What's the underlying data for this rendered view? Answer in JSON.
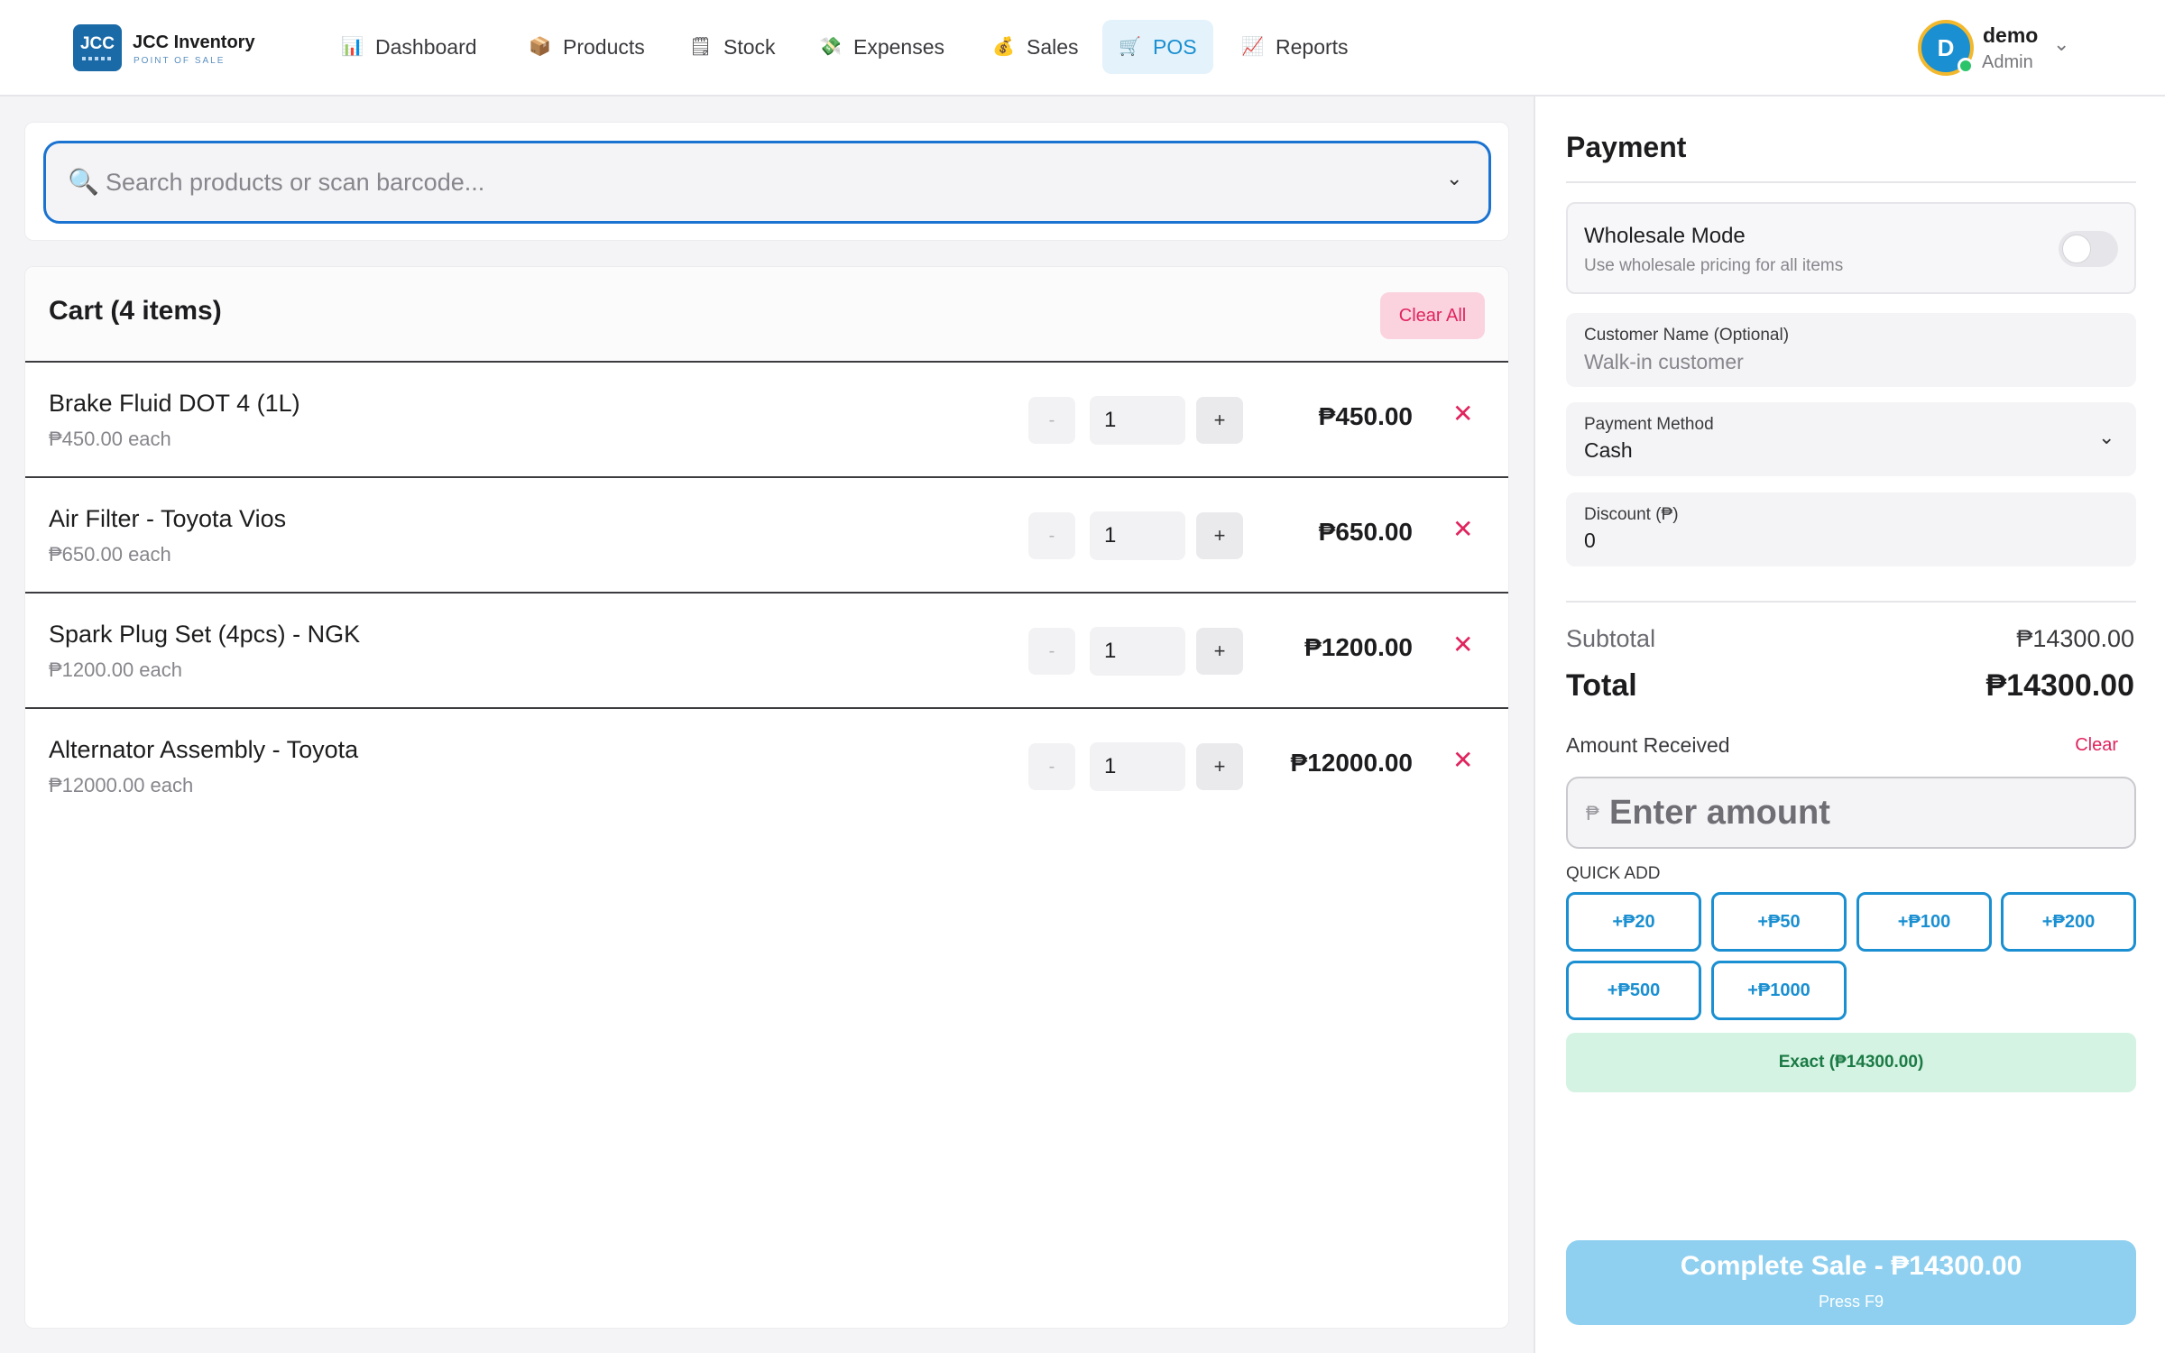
{
  "brand": {
    "logo_text": "JCC",
    "name": "JCC Inventory",
    "subtitle": "POINT OF SALE"
  },
  "nav": [
    {
      "label": "Dashboard",
      "icon": "📊",
      "icon_name": "bar-chart-icon"
    },
    {
      "label": "Products",
      "icon": "📦",
      "icon_name": "package-icon"
    },
    {
      "label": "Stock",
      "icon": "🗒",
      "icon_name": "clipboard-icon"
    },
    {
      "label": "Expenses",
      "icon": "💸",
      "icon_name": "money-wings-icon"
    },
    {
      "label": "Sales",
      "icon": "💰",
      "icon_name": "money-bag-icon"
    },
    {
      "label": "POS",
      "icon": "🛒",
      "icon_name": "cart-icon",
      "active": true
    },
    {
      "label": "Reports",
      "icon": "📈",
      "icon_name": "line-chart-icon"
    }
  ],
  "user": {
    "initial": "D",
    "name": "demo",
    "role": "Admin"
  },
  "search": {
    "placeholder": "Search products or scan barcode..."
  },
  "cart": {
    "title": "Cart (4 items)",
    "clear_all": "Clear All",
    "items": [
      {
        "name": "Brake Fluid DOT 4 (1L)",
        "each": "₱450.00 each",
        "qty": "1",
        "total": "₱450.00"
      },
      {
        "name": "Air Filter - Toyota Vios",
        "each": "₱650.00 each",
        "qty": "1",
        "total": "₱650.00"
      },
      {
        "name": "Spark Plug Set (4pcs) - NGK",
        "each": "₱1200.00 each",
        "qty": "1",
        "total": "₱1200.00"
      },
      {
        "name": "Alternator Assembly - Toyota",
        "each": "₱12000.00 each",
        "qty": "1",
        "total": "₱12000.00"
      }
    ],
    "minus": "-",
    "plus": "+",
    "remove": "✕"
  },
  "payment": {
    "title": "Payment",
    "wholesale": {
      "title": "Wholesale Mode",
      "subtitle": "Use wholesale pricing for all items",
      "enabled": false
    },
    "customer": {
      "label": "Customer Name (Optional)",
      "placeholder": "Walk-in customer"
    },
    "method": {
      "label": "Payment Method",
      "value": "Cash"
    },
    "discount": {
      "label": "Discount (₱)",
      "value": "0"
    },
    "subtotal_label": "Subtotal",
    "subtotal_value": "₱14300.00",
    "total_label": "Total",
    "total_value": "₱14300.00",
    "amount_label": "Amount Received",
    "amount_clear": "Clear",
    "amount_currency": "₱",
    "amount_placeholder": "Enter amount",
    "quick_label": "QUICK ADD",
    "quick": [
      "+₱20",
      "+₱50",
      "+₱100",
      "+₱200",
      "+₱500",
      "+₱1000"
    ],
    "exact": "Exact (₱14300.00)",
    "complete": "Complete Sale - ₱14300.00",
    "complete_hint": "Press F9"
  },
  "colors": {
    "accent": "#1a8fd1",
    "danger": "#e0245e",
    "success": "#1b7a45",
    "brand": "#1b6aa8"
  }
}
